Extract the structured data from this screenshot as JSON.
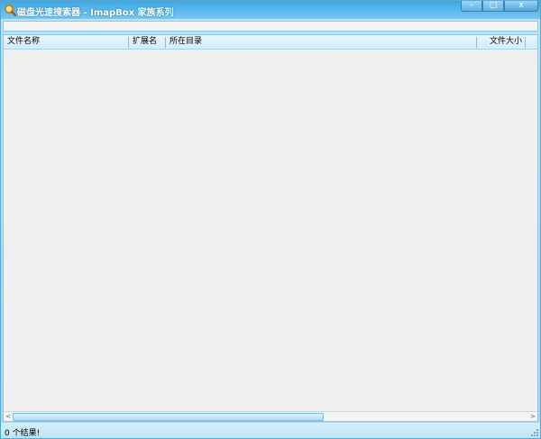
{
  "window": {
    "title": "磁盘光速搜索器 - ImapBox 家族系列",
    "icon": "magnifier-icon",
    "buttons": {
      "minimize": "–",
      "maximize": "□",
      "close": "x"
    }
  },
  "list": {
    "columns": [
      "文件名称",
      "扩展名",
      "所在目录",
      "文件大小"
    ],
    "rows": []
  },
  "scrollbar": {
    "left_arrow": "<",
    "right_arrow": ">"
  },
  "status": {
    "text": "0 个结果!"
  },
  "colors": {
    "title_bar": "#3aa8e6",
    "frame": "#bfe3f6",
    "list_bg": "#f0f0f0"
  }
}
